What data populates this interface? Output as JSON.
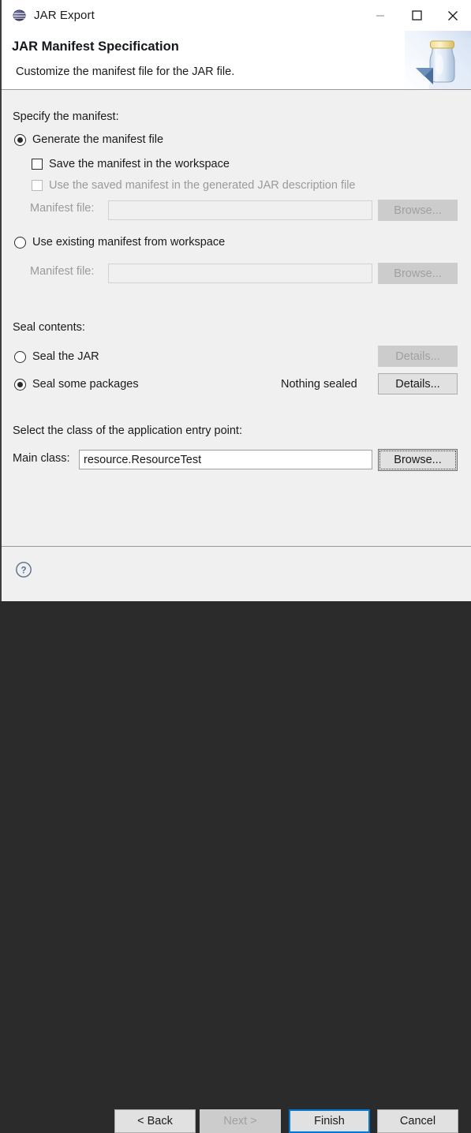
{
  "window": {
    "title": "JAR Export",
    "icon": "jar-export-icon",
    "controls": {
      "minimize": "minimize-icon",
      "maximize": "maximize-icon",
      "close": "close-icon"
    }
  },
  "header": {
    "title": "JAR Manifest Specification",
    "subtitle": "Customize the manifest file for the JAR file.",
    "banner_icon": "jar-bottle-icon"
  },
  "manifest": {
    "group_label": "Specify the manifest:",
    "generate_radio": {
      "label": "Generate the manifest file",
      "checked": true
    },
    "save_checkbox": {
      "label": "Save the manifest in the workspace",
      "checked": false,
      "enabled": true
    },
    "use_saved_checkbox": {
      "label": "Use the saved manifest in the generated JAR description file",
      "checked": false,
      "enabled": false
    },
    "manifest_file_1": {
      "label": "Manifest file:",
      "value": "",
      "placeholder": "",
      "enabled": false,
      "browse_label": "Browse...",
      "browse_enabled": false
    },
    "use_existing_radio": {
      "label": "Use existing manifest from workspace",
      "checked": false
    },
    "manifest_file_2": {
      "label": "Manifest file:",
      "value": "",
      "placeholder": "",
      "enabled": false,
      "browse_label": "Browse...",
      "browse_enabled": false
    }
  },
  "seal": {
    "group_label": "Seal contents:",
    "seal_jar_radio": {
      "label": "Seal the JAR",
      "checked": false
    },
    "seal_jar_details": {
      "label": "Details...",
      "enabled": false
    },
    "seal_packages_radio": {
      "label": "Seal some packages",
      "checked": true
    },
    "seal_status": "Nothing sealed",
    "seal_packages_details": {
      "label": "Details...",
      "enabled": true
    }
  },
  "entry_point": {
    "group_label": "Select the class of the application entry point:",
    "main_class_label": "Main class:",
    "main_class_value": "resource.ResourceTest",
    "browse_label": "Browse...",
    "browse_focused": true
  },
  "buttonbar": {
    "help_icon": "help-icon",
    "back": {
      "label": "< Back",
      "enabled": true
    },
    "next": {
      "label": "Next >",
      "enabled": false
    },
    "finish": {
      "label": "Finish",
      "enabled": true,
      "default": true
    },
    "cancel": {
      "label": "Cancel",
      "enabled": true
    }
  },
  "colors": {
    "accent": "#0078d7",
    "dialog_bg": "#f0f0f0",
    "header_bg": "#ffffff",
    "disabled_text": "#9a9a9a",
    "button_bg": "#e1e1e1",
    "button_disabled_bg": "#cccccc"
  }
}
